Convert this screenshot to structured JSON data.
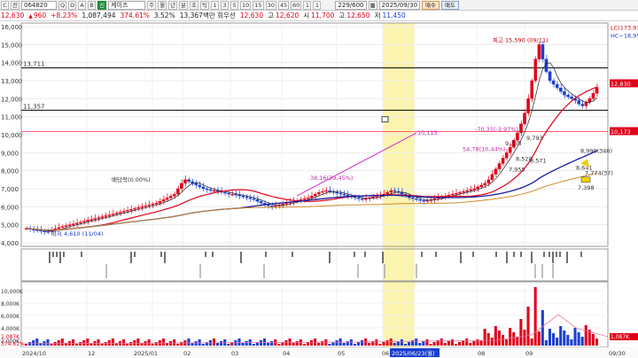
{
  "toolbar": {
    "icon_c": "C",
    "dropdown": "전",
    "code": "064820",
    "sub_icons": [
      "Q",
      "D",
      "A",
      "B"
    ],
    "badge": "신",
    "name": "케이즈",
    "periods": [
      "주",
      "월",
      "년",
      "분",
      "초",
      "틱",
      "1",
      "3",
      "5",
      "10",
      "15",
      "30",
      "45",
      "60",
      "1",
      "1"
    ],
    "page": "229/600",
    "date": "2025/09/30",
    "sell": "매수",
    "buy": "매도"
  },
  "quote": {
    "price": "12,630",
    "change_arrow": "▲",
    "change": "960",
    "change_pct": "+8.23%",
    "volume": "1,087,494",
    "volume_ratio": "374.61%",
    "turnover": "3.52%",
    "amount": "13,367백만",
    "caption": "회우선",
    "price2": "12,630",
    "high_label": "고",
    "high": "12,620",
    "open_label": "시",
    "open": "11,700",
    "high2_label": "고",
    "high2": "12,650",
    "low_label": "저",
    "low": "11,450"
  },
  "chart_data": {
    "type": "candlestick",
    "y_axis_ticks": [
      "16,000",
      "15,000",
      "14,000",
      "13,000",
      "12,000",
      "11,000",
      "10,000",
      "9,000",
      "8,000",
      "7,000",
      "6,000",
      "5,000",
      "4,000"
    ],
    "y_range": [
      3800,
      16200
    ],
    "right_labels": [
      {
        "text": "LC(173.97)",
        "value": 15950,
        "color": "#cc0000"
      },
      {
        "text": "HC~18,95",
        "value": 15500,
        "color": "#1a3fd0"
      },
      {
        "text": "12,830",
        "value": 12830,
        "color": "#ffffff",
        "bg": "#e0001a"
      },
      {
        "text": "10,173",
        "value": 10173,
        "color": "#ffffff",
        "bg": "#e0001a"
      }
    ],
    "hlines": [
      {
        "label": "13,711",
        "value": 13711
      },
      {
        "label": "11,357",
        "value": 11357
      }
    ],
    "pink_line": 10173,
    "annotations": {
      "high": "최고 15,590 (09/11)",
      "low": "최저 4,610 (11/04)",
      "dividend": "배당락(0.00%)",
      "pct1": "38,16(39,45%)",
      "target1": "10,115",
      "pct2": "-70,35(-3,97%)",
      "pct3": "54,78(10,44%)",
      "v9358": "9,358",
      "v9793": "9,793",
      "v8528": "8,528",
      "v8571": "8,571",
      "v8641": "8,641",
      "v7955": "7,955",
      "v8999": "8,999(346)",
      "v7774": "7,774(37)",
      "v7398": "7,398"
    },
    "x_labels": [
      "2024/10",
      "12",
      "2025/01",
      "02",
      "03",
      "04",
      "05",
      "06",
      "2025/06/23(월)",
      "08",
      "09",
      "09/30"
    ],
    "volume_ticks": [
      "10,000K",
      "8,000K",
      "6,000K",
      "4,000K",
      "2,000K"
    ],
    "volume_badge": "1,087K",
    "volume_badge2": "374.61%",
    "series_close": [
      4800,
      4750,
      4720,
      4690,
      4650,
      4620,
      4610,
      4700,
      4780,
      4850,
      4900,
      4950,
      5000,
      5050,
      5100,
      5150,
      5200,
      5260,
      5300,
      5350,
      5400,
      5450,
      5500,
      5550,
      5600,
      5650,
      5700,
      5750,
      5800,
      5850,
      5900,
      5950,
      6000,
      6050,
      6100,
      6150,
      6200,
      6300,
      6400,
      6500,
      6600,
      6700,
      7000,
      7300,
      7500,
      7400,
      7300,
      7200,
      7100,
      7000,
      6950,
      6900,
      6900,
      6850,
      6800,
      6750,
      6700,
      6700,
      6650,
      6600,
      6550,
      6500,
      6450,
      6400,
      6300,
      6200,
      6100,
      6050,
      6000,
      6050,
      6100,
      6150,
      6200,
      6250,
      6300,
      6350,
      6400,
      6450,
      6500,
      6600,
      6700,
      6800,
      6850,
      6900,
      6850,
      6800,
      6750,
      6700,
      6650,
      6600,
      6550,
      6500,
      6450,
      6400,
      6450,
      6500,
      6550,
      6600,
      6650,
      6700,
      6800,
      6900,
      6850,
      6800,
      6700,
      6600,
      6500,
      6450,
      6400,
      6350,
      6300,
      6350,
      6400,
      6450,
      6500,
      6550,
      6600,
      6650,
      6700,
      6750,
      6800,
      6850,
      6900,
      6950,
      7000,
      7100,
      7200,
      7300,
      7500,
      7800,
      8100,
      8400,
      8700,
      9000,
      9300,
      9700,
      10100,
      10600,
      11200,
      12000,
      13000,
      14200,
      15000,
      14200,
      13500,
      13000,
      12800,
      12600,
      12400,
      12200,
      12100,
      12000,
      11900,
      11700,
      11600,
      11800,
      12000,
      12300,
      12630
    ]
  }
}
